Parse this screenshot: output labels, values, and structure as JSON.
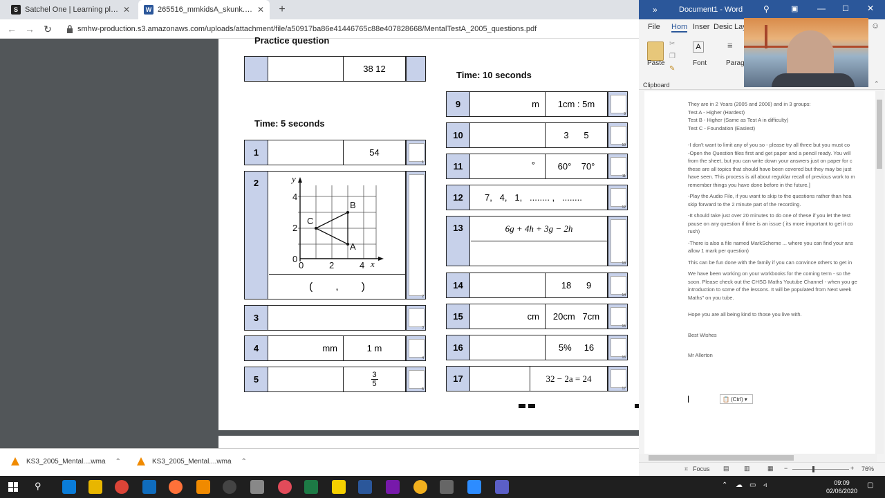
{
  "browser": {
    "tabs": [
      {
        "title": "Satchel One | Learning platform",
        "favicon": "S"
      },
      {
        "title": "265516_mmkidsA_skunk.qxp",
        "favicon": "W"
      }
    ],
    "url": "smhw-production.s3.amazonaws.com/uploads/attachment/file/a50917ba86e41446765c88e407828668/MentalTestA_2005_questions.pdf"
  },
  "pdf": {
    "practice_heading": "Practice question",
    "practice_value": "38     12",
    "time5": "Time:  5 seconds",
    "time10": "Time:  10 seconds",
    "left_questions": [
      {
        "num": "1",
        "unit": "",
        "value": "54",
        "mark": "1"
      },
      {
        "num": "2",
        "unit": "",
        "value": "",
        "mark": "2"
      },
      {
        "num": "3",
        "unit": "",
        "value": "",
        "mark": "3"
      },
      {
        "num": "4",
        "unit": "mm",
        "value": "1 m",
        "mark": "4"
      },
      {
        "num": "5",
        "unit": "",
        "value": "3/5",
        "mark": "5"
      }
    ],
    "grid": {
      "y_label": "y",
      "x_label": "x",
      "y_ticks": [
        "4",
        "2",
        "0"
      ],
      "x_ticks": [
        "0",
        "2",
        "4"
      ],
      "points": [
        "C",
        "B",
        "A"
      ]
    },
    "coord_answer": "(        ,        )",
    "fraction_num": "3",
    "fraction_den": "5",
    "right_questions": [
      {
        "num": "9",
        "unit": "m",
        "value": "1cm : 5m",
        "mark": "9"
      },
      {
        "num": "10",
        "unit": "",
        "value": "3      5",
        "mark": "10"
      },
      {
        "num": "11",
        "unit": "°",
        "value": "60°    70°",
        "mark": "11"
      },
      {
        "num": "12",
        "unit": "",
        "value": "7,   4,   1,   ........ ,   ........",
        "mark": "12"
      },
      {
        "num": "13",
        "unit": "",
        "value": "6g + 4h + 3g − 2h",
        "mark": "13"
      },
      {
        "num": "14",
        "unit": "",
        "value": "18      9",
        "mark": "14"
      },
      {
        "num": "15",
        "unit": "cm",
        "value": "20cm   7cm",
        "mark": "15"
      },
      {
        "num": "16",
        "unit": "",
        "value": "5%     16",
        "mark": "16"
      },
      {
        "num": "17",
        "unit": "",
        "value": "32 − 2a = 24",
        "mark": "17"
      }
    ]
  },
  "word": {
    "title": "Document1 - Word",
    "tabs": [
      "File",
      "Hom",
      "Inser",
      "Desic",
      "Lay"
    ],
    "ribbon": {
      "paste": "Paste",
      "font": "Font",
      "paragraph": "Paragrap",
      "clipboard": "Clipboard"
    },
    "doc_lines": [
      "They are in 2 Years (2005 and 2006) and in 3 groups:",
      "Test A - Higher (Hardest)",
      "Test B - Higher (Same as Test A in difficulty)",
      "Test C - Foundation (Easiest)",
      "",
      "-I don't want to limit any of you so - please try all three but you must co",
      "-Open the Question files first and get paper and a pencil ready. You will",
      "from the sheet, but you can write down your answers just on paper for c",
      "these are all topics that should have been covered but they may be just",
      "have seen. This process is all about reguklar recall of previous work to m",
      "remember things you have done before in the future.]",
      "-Play the Audio File, if you want to skip to the questions rather than hea",
      "skip forward to the 2 minute part of the recording.",
      "-It should take just over 20 minutes to do one of these if you let the test",
      "pause on any question if time is an issue ( its more important to get it co",
      "rush)",
      "-There is also a file named MarkScheme ... where you can find your ans",
      "allow 1 mark per question)",
      "This can be fun done with the family if you can convince others to get in",
      "We have been working on your workbooks for the coming term - so the",
      "soon. Please check out the CHSG Maths Youtube Channel - when you ge",
      "introduction to some of the lessons. It will be populated from Next week",
      "Maths\" on you tube.",
      "",
      "Hope you are all being kind to those you live with.",
      "",
      "Best Wishes",
      "",
      "Mr Allerton"
    ],
    "paste_ctrl": "(Ctrl)",
    "status": {
      "focus": "Focus",
      "zoom": "76%"
    }
  },
  "downloads": [
    "KS3_2005_Mental....wma",
    "KS3_2005_Mental....wma"
  ],
  "taskbar": {
    "time": "09:09",
    "date": "02/06/2020"
  }
}
